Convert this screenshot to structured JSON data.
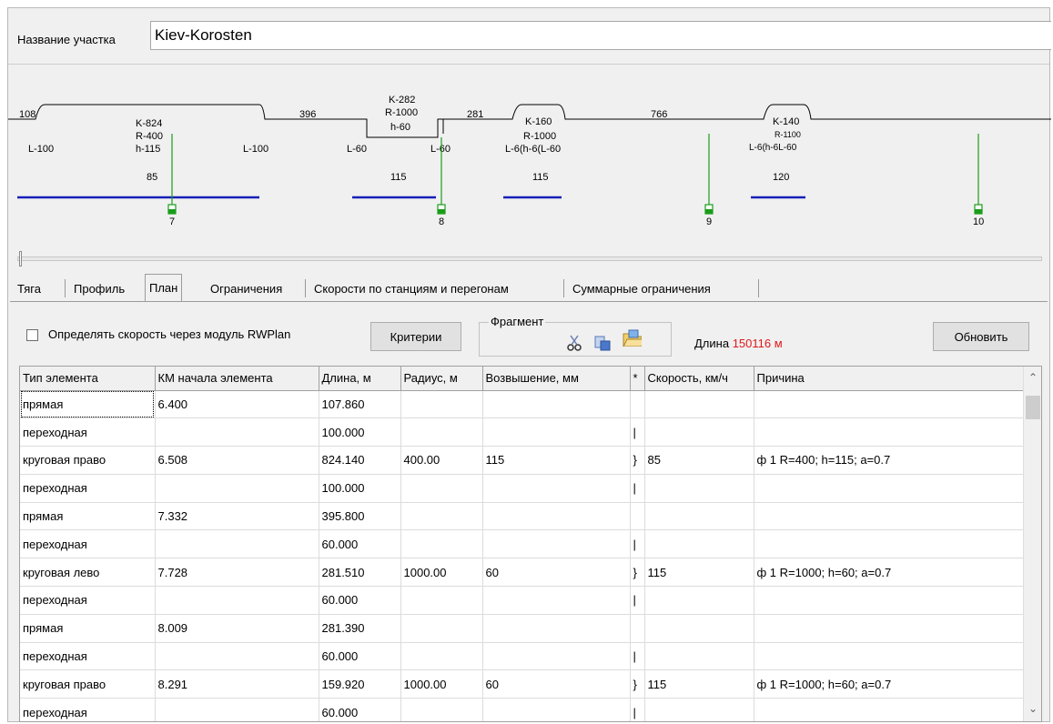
{
  "section": {
    "label": "Название участка",
    "value": "Kiev-Korosten"
  },
  "diagram": {
    "track_labels": [
      "108",
      "396",
      "281",
      "766"
    ],
    "curves": [
      {
        "id": "K-824",
        "radius": "R-400",
        "height": "h-115",
        "left_transition": "L-100",
        "right_transition": "L-100",
        "speed": "85",
        "station": "7"
      },
      {
        "id": "K-282",
        "radius": "R-1000",
        "height": "h-60",
        "left_transition": "L-60",
        "right_transition": "L-60",
        "speed": "115",
        "station": "8"
      },
      {
        "id": "K-160",
        "radius": "R-1000",
        "height_combo": "L-6(h-6(L-60",
        "speed": "115"
      },
      {
        "id": "K-140",
        "radius": "R-1100",
        "height_combo": "L-6(h-6L-60",
        "speed": "120"
      }
    ],
    "stations": [
      "7",
      "8",
      "9",
      "10"
    ],
    "colors": {
      "track": "#000000",
      "speed": "#1520b8",
      "marker": "#1a9c1a"
    }
  },
  "tabs": [
    {
      "label": "Тяга",
      "active": false
    },
    {
      "label": "Профиль",
      "active": false
    },
    {
      "label": "План",
      "active": true
    },
    {
      "label": "Ограничения",
      "active": false
    },
    {
      "label": "Скорости по станциям и перегонам",
      "active": false
    },
    {
      "label": "Суммарные ограничения",
      "active": false
    }
  ],
  "toolbar": {
    "checkbox_label": "Определять скорость через модуль RWPlan",
    "checkbox_checked": false,
    "criteria_button": "Критерии",
    "fragment_label": "Фрагмент",
    "fragment_icons": [
      "cut-icon",
      "paste-icon",
      "folder-icon"
    ],
    "length_label": "Длина",
    "length_value": "150116 м",
    "refresh_button": "Обновить"
  },
  "table": {
    "columns": [
      "Тип элемента",
      "КМ начала элемента",
      "Длина, м",
      "Радиус, м",
      "Возвышение, мм",
      "*",
      "Скорость, км/ч",
      "Причина"
    ],
    "rows": [
      [
        "прямая",
        "6.400",
        "107.860",
        "",
        "",
        "",
        "",
        ""
      ],
      [
        "переходная",
        "",
        "100.000",
        "",
        "",
        "|",
        "",
        ""
      ],
      [
        "круговая право",
        "6.508",
        "824.140",
        "400.00",
        "115",
        "}",
        "85",
        "ф 1  R=400; h=115; a=0.7"
      ],
      [
        "переходная",
        "",
        "100.000",
        "",
        "",
        "|",
        "",
        ""
      ],
      [
        "прямая",
        "7.332",
        "395.800",
        "",
        "",
        "",
        "",
        ""
      ],
      [
        "переходная",
        "",
        "60.000",
        "",
        "",
        "|",
        "",
        ""
      ],
      [
        "круговая лево",
        "7.728",
        "281.510",
        "1000.00",
        "60",
        "}",
        "115",
        "ф 1  R=1000; h=60; a=0.7"
      ],
      [
        "переходная",
        "",
        "60.000",
        "",
        "",
        "|",
        "",
        ""
      ],
      [
        "прямая",
        "8.009",
        "281.390",
        "",
        "",
        "",
        "",
        ""
      ],
      [
        "переходная",
        "",
        "60.000",
        "",
        "",
        "|",
        "",
        ""
      ],
      [
        "круговая право",
        "8.291",
        "159.920",
        "1000.00",
        "60",
        "}",
        "115",
        "ф 1  R=1000; h=60; a=0.7"
      ],
      [
        "переходная",
        "",
        "60.000",
        "",
        "",
        "|",
        "",
        ""
      ]
    ]
  }
}
